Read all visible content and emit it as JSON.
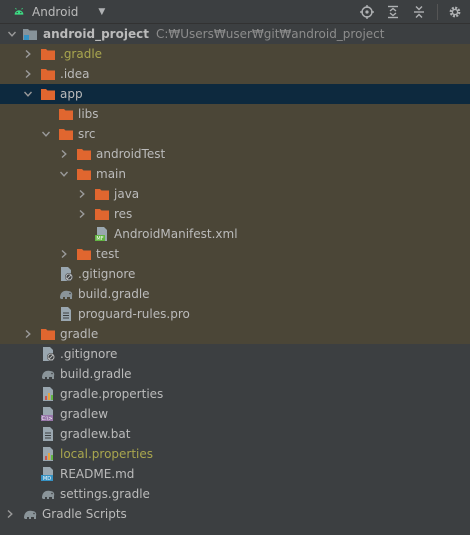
{
  "toolbar": {
    "view_mode": "Android",
    "icons": [
      "locate-icon",
      "expand-all-icon",
      "collapse-all-icon",
      "settings-icon"
    ]
  },
  "colors": {
    "background": "#3c3f41",
    "tinted_row": "#4b4637",
    "selected_row": "#0d293e",
    "folder": "#e0662f",
    "ignored_text": "#a9a64e"
  },
  "tree": {
    "root": {
      "label": "android_project",
      "path": "C:₩Users₩user₩git₩android_project"
    },
    "items": [
      {
        "label": ".gradle"
      },
      {
        "label": ".idea"
      },
      {
        "label": "app"
      },
      {
        "label": "libs"
      },
      {
        "label": "src"
      },
      {
        "label": "androidTest"
      },
      {
        "label": "main"
      },
      {
        "label": "java"
      },
      {
        "label": "res"
      },
      {
        "label": "AndroidManifest.xml"
      },
      {
        "label": "test"
      },
      {
        "label": ".gitignore"
      },
      {
        "label": "build.gradle"
      },
      {
        "label": "proguard-rules.pro"
      },
      {
        "label": "gradle"
      },
      {
        "label": ".gitignore"
      },
      {
        "label": "build.gradle"
      },
      {
        "label": "gradle.properties"
      },
      {
        "label": "gradlew"
      },
      {
        "label": "gradlew.bat"
      },
      {
        "label": "local.properties"
      },
      {
        "label": "README.md"
      },
      {
        "label": "settings.gradle"
      },
      {
        "label": "Gradle Scripts"
      }
    ]
  }
}
